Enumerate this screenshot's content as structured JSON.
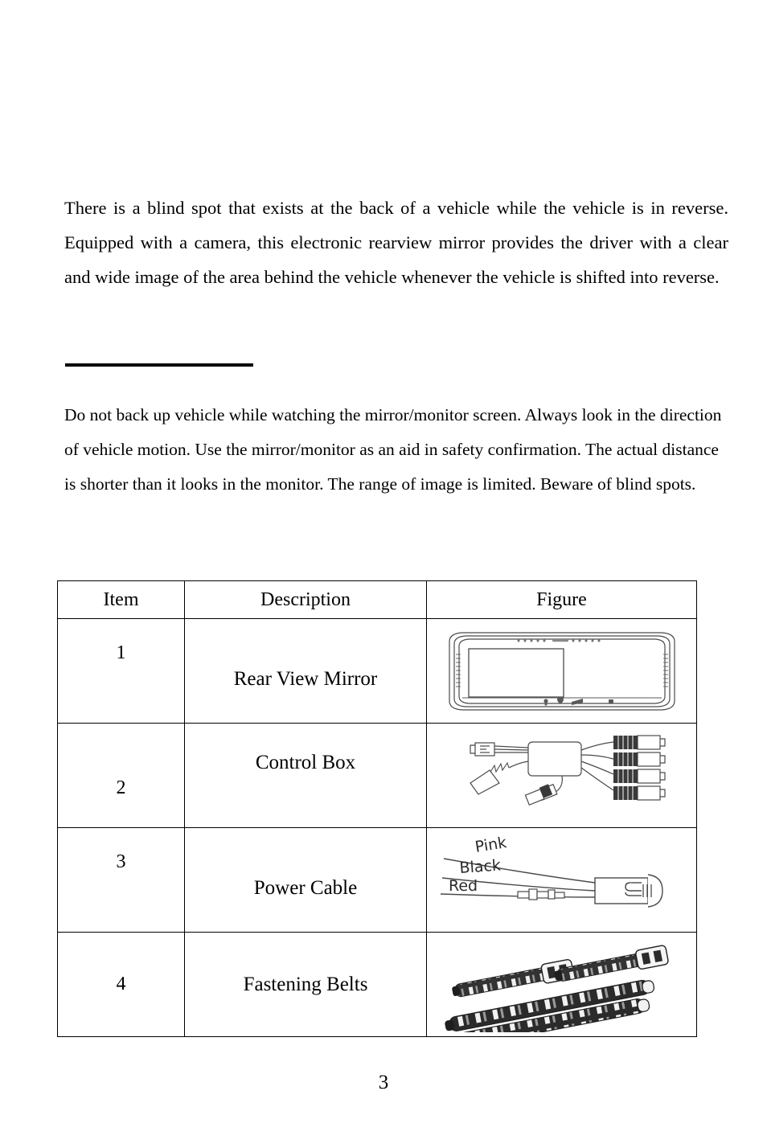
{
  "document": {
    "page_number": "3",
    "intro_paragraph": "There is a blind spot that exists at the back of a vehicle while the vehicle is in reverse. Equipped with a camera, this electronic rearview mirror provides the driver with a clear and wide image of the area behind the vehicle whenever the vehicle is shifted into reverse.",
    "note_paragraph": "Do not back up vehicle while watching the mirror/monitor screen. Always look in the direction of vehicle motion. Use the mirror/monitor as an aid in safety confirmation. The actual distance is shorter than it looks in the monitor. The range of image is limited. Beware of blind spots."
  },
  "parts_table": {
    "headers": {
      "item": "Item",
      "description": "Description",
      "figure": "Figure"
    },
    "rows": [
      {
        "item": "1",
        "description": "Rear View Mirror",
        "figure_name": "rear-view-mirror-diagram"
      },
      {
        "item": "2",
        "description": "Control Box",
        "figure_name": "control-box-diagram"
      },
      {
        "item": "3",
        "description": "Power Cable",
        "figure_name": "power-cable-diagram"
      },
      {
        "item": "4",
        "description": "Fastening Belts",
        "figure_name": "fastening-belts-diagram"
      }
    ]
  },
  "figure_labels": {
    "power_cable": {
      "wire_pink": "Pink",
      "wire_black": "Black",
      "wire_red": "Red"
    }
  },
  "colors": {
    "text": "#000000",
    "page_background": "#ffffff",
    "table_border": "#000000",
    "line_art": "#3a3a3a",
    "belt_dark": "#2b2b2b"
  }
}
